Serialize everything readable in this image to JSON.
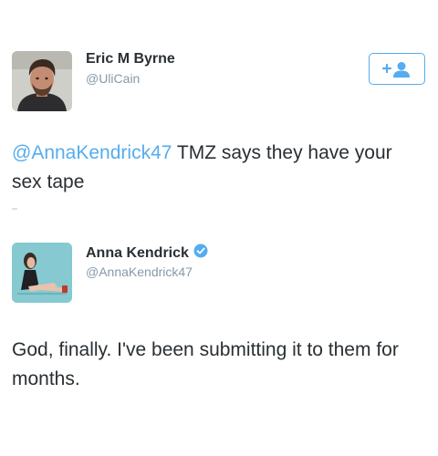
{
  "tweet_1": {
    "display_name": "Eric M Byrne",
    "handle": "@UliCain",
    "avatar_icon": "person-photo-avatar",
    "follow_icon": "add-user-icon",
    "text_mention": "@AnnaKendrick47",
    "text_body": " TMZ says they have your sex tape"
  },
  "tweet_2": {
    "display_name": "Anna Kendrick",
    "verified_icon": "verified-badge-icon",
    "handle": "@AnnaKendrick47",
    "avatar_icon": "person-photo-avatar",
    "text": "God, finally. I've been submitting it to them for months."
  },
  "colors": {
    "link": "#55acee",
    "text": "#292f33",
    "muted": "#8899a6"
  }
}
